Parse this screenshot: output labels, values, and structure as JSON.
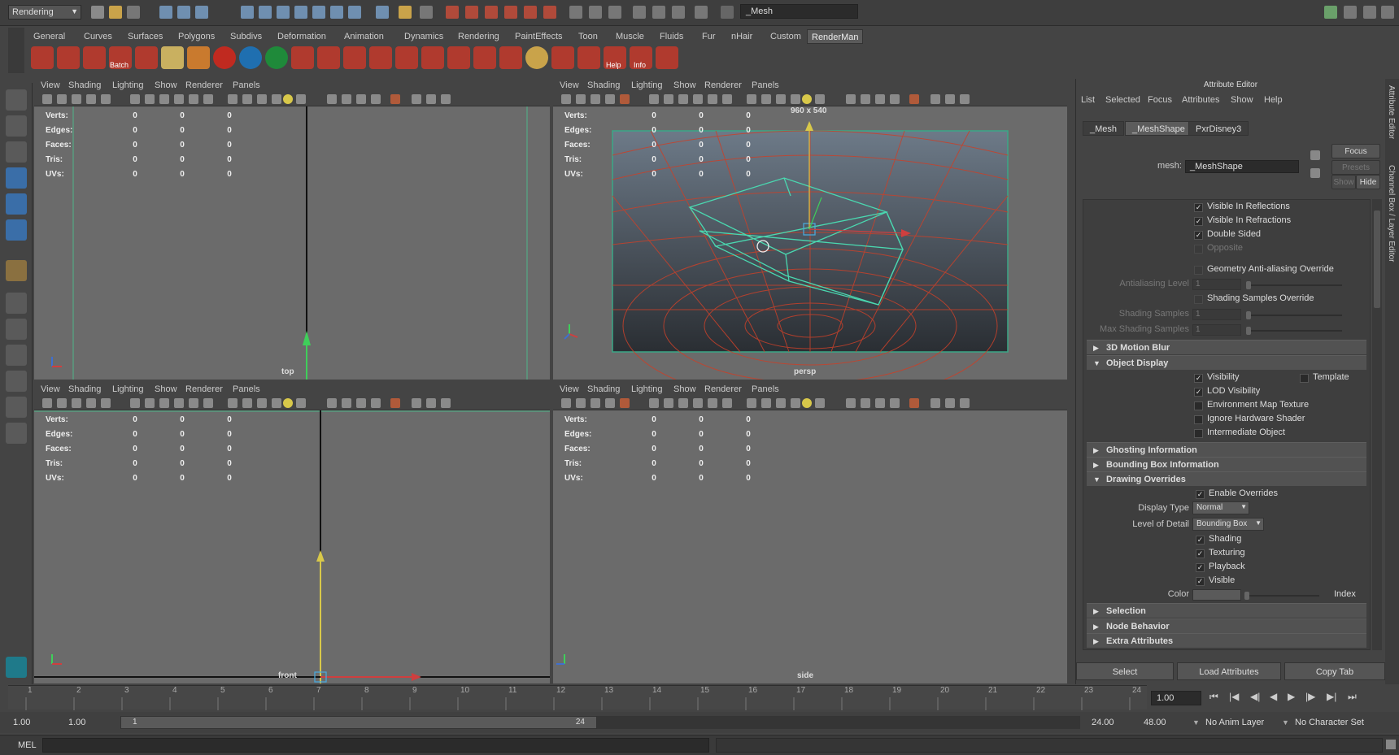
{
  "app": {
    "mode_menu": "Rendering",
    "object_name": "_Mesh"
  },
  "shelf_tabs": [
    "General",
    "Curves",
    "Surfaces",
    "Polygons",
    "Subdivs",
    "Deformation",
    "Animation",
    "Dynamics",
    "Rendering",
    "PaintEffects",
    "Toon",
    "Muscle",
    "Fluids",
    "Fur",
    "nHair",
    "Custom",
    "RenderMan"
  ],
  "shelf_active_tab": "RenderMan",
  "shelf_icon_labels": {
    "batch": "Batch",
    "help": "Help",
    "info": "Info"
  },
  "panel_menu": [
    "View",
    "Shading",
    "Lighting",
    "Show",
    "Renderer",
    "Panels"
  ],
  "hud_labels": [
    "Verts:",
    "Edges:",
    "Faces:",
    "Tris:",
    "UVs:"
  ],
  "hud_value": "0",
  "viewports": {
    "top": {
      "label": "top"
    },
    "persp": {
      "label": "persp",
      "resolution": "960 x 540"
    },
    "front": {
      "label": "front"
    },
    "side": {
      "label": "side"
    }
  },
  "attribute_editor": {
    "title": "Attribute Editor",
    "menu": [
      "List",
      "Selected",
      "Focus",
      "Attributes",
      "Show",
      "Help"
    ],
    "tabs": [
      "_Mesh",
      "_MeshShape",
      "PxrDisney3"
    ],
    "active_tab": "_MeshShape",
    "focus_btn": "Focus",
    "presets_btn": "Presets",
    "show_btn": "Show",
    "hide_btn": "Hide",
    "mesh_label": "mesh:",
    "mesh_value": "_MeshShape",
    "render_checks": [
      {
        "label": "Visible In Reflections",
        "checked": true,
        "dim": false
      },
      {
        "label": "Visible In Refractions",
        "checked": true,
        "dim": false
      },
      {
        "label": "Double Sided",
        "checked": true,
        "dim": false
      },
      {
        "label": "Opposite",
        "checked": false,
        "dim": true
      }
    ],
    "geom_aa": "Geometry Anti-aliasing Override",
    "aa_level_label": "Antialiasing Level",
    "aa_level_value": "1",
    "shading_samples_override": "Shading Samples Override",
    "shading_samples_label": "Shading Samples",
    "shading_samples_value": "1",
    "max_shading_samples_label": "Max Shading Samples",
    "max_shading_samples_value": "1",
    "sections": {
      "motion_blur": "3D Motion Blur",
      "object_display": "Object Display",
      "ghosting": "Ghosting Information",
      "bounding_box": "Bounding Box Information",
      "drawing_overrides": "Drawing Overrides",
      "selection": "Selection",
      "node_behavior": "Node Behavior",
      "extra_attributes": "Extra Attributes"
    },
    "object_display": {
      "visibility": "Visibility",
      "template": "Template",
      "lod_visibility": "LOD Visibility",
      "env_map": "Environment Map Texture",
      "ignore_hw": "Ignore Hardware Shader",
      "intermediate": "Intermediate Object"
    },
    "drawing_overrides": {
      "enable": "Enable Overrides",
      "display_type_label": "Display Type",
      "display_type_value": "Normal",
      "lod_label": "Level of Detail",
      "lod_value": "Bounding Box",
      "shading": "Shading",
      "texturing": "Texturing",
      "playback": "Playback",
      "visible": "Visible",
      "color_label": "Color",
      "index_label": "Index"
    },
    "bottom_buttons": [
      "Select",
      "Load Attributes",
      "Copy Tab"
    ]
  },
  "right_strip": {
    "attribute_editor": "Attribute Editor",
    "channel_box": "Channel Box / Layer Editor"
  },
  "timeline": {
    "ticks": [
      "1",
      "2",
      "3",
      "4",
      "5",
      "6",
      "7",
      "8",
      "9",
      "10",
      "11",
      "12",
      "13",
      "14",
      "15",
      "16",
      "17",
      "18",
      "19",
      "20",
      "21",
      "22",
      "23",
      "24"
    ],
    "current_frame": "1.00"
  },
  "range": {
    "start_time": "1.00",
    "playback_start": "1.00",
    "range_start": "1",
    "range_end": "24",
    "playback_end": "24.00",
    "end_time": "48.00",
    "anim_layer": "No Anim Layer",
    "character_set": "No Character Set"
  },
  "command_line": {
    "lang": "MEL"
  }
}
